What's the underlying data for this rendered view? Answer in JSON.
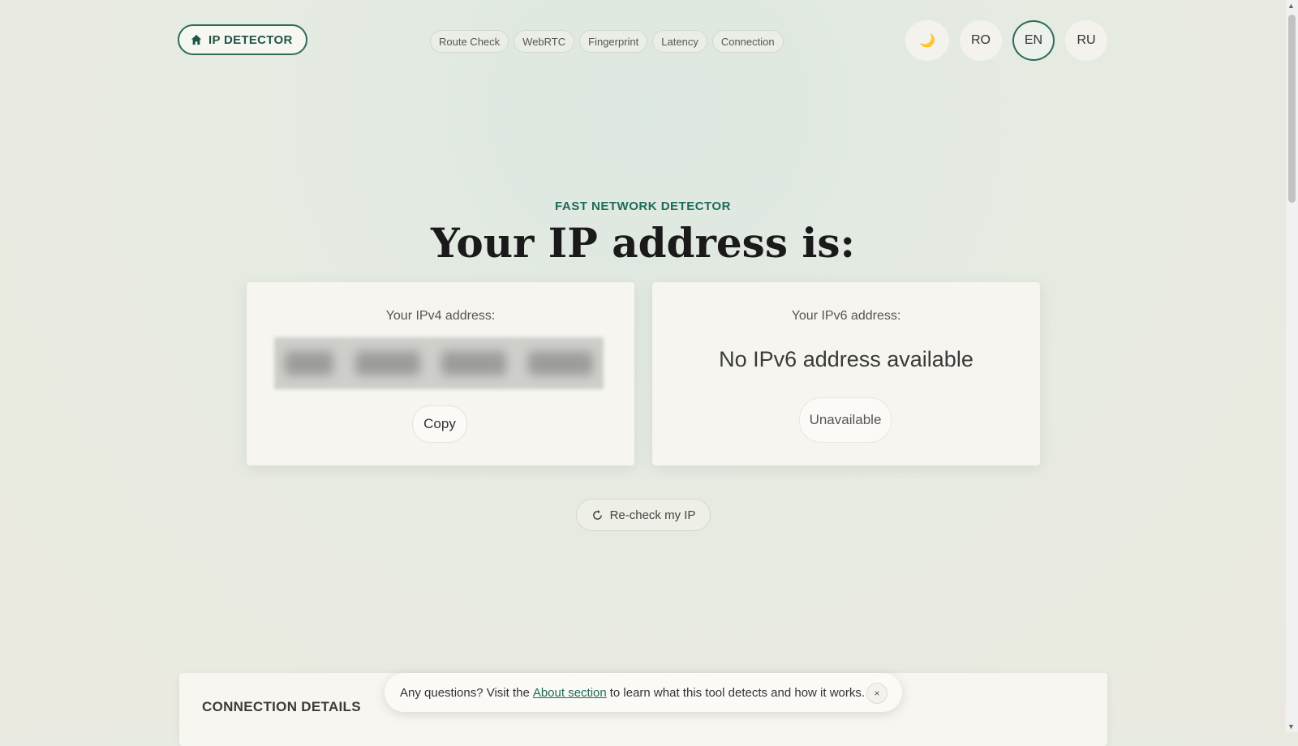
{
  "header": {
    "brand_label": "IP DETECTOR",
    "nav": [
      {
        "label": "Route Check"
      },
      {
        "label": "WebRTC"
      },
      {
        "label": "Fingerprint"
      },
      {
        "label": "Latency"
      },
      {
        "label": "Connection"
      }
    ],
    "theme_icon": "🌙",
    "languages": [
      {
        "label": "RO",
        "active": false
      },
      {
        "label": "EN",
        "active": true
      },
      {
        "label": "RU",
        "active": false
      }
    ]
  },
  "hero": {
    "eyebrow": "FAST NETWORK DETECTOR",
    "title": "Your IP address is:"
  },
  "ipv4": {
    "label": "Your IPv4 address:",
    "copy_label": "Copy"
  },
  "ipv6": {
    "label": "Your IPv6 address:",
    "value": "No IPv6 address available",
    "button_label": "Unavailable"
  },
  "recheck_label": "Re-check my IP",
  "details": {
    "title": "CONNECTION DETAILS"
  },
  "toast": {
    "prefix": "Any questions? Visit the",
    "link": "About section",
    "suffix": "to learn what this tool detects and how it works.",
    "close": "×"
  },
  "colors": {
    "accent": "#2d6b5c",
    "eyebrow": "#1f6a5a"
  }
}
